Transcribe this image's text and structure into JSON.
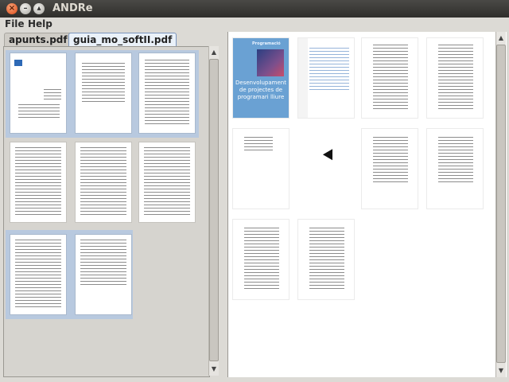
{
  "window": {
    "title": "ANDRe"
  },
  "menu": {
    "items": [
      "File",
      "Help"
    ]
  },
  "tabs": [
    {
      "label": "apunts.pdf",
      "active": false
    },
    {
      "label": "guia_mo_softII.pdf",
      "active": true
    }
  ],
  "cover": {
    "header_label": "Programació",
    "title_line1": "Desenvolupament",
    "title_line2": "de projectes de",
    "title_line3": "programari lliure"
  },
  "colors": {
    "titlebar": "#3c3b37",
    "selection": "#b8c9df",
    "cover_blue": "#6aa1d3"
  }
}
